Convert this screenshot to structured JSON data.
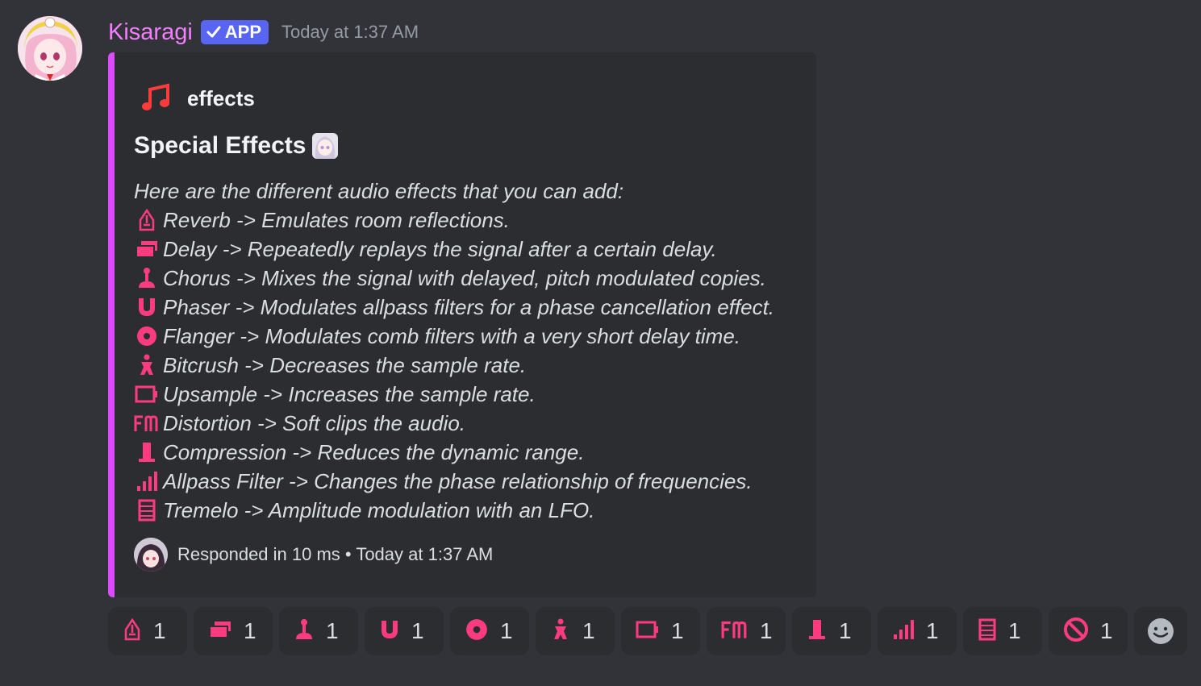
{
  "message": {
    "username": "Kisaragi",
    "badge": "APP",
    "timestamp": "Today at 1:37 AM"
  },
  "embed": {
    "author": "effects",
    "title": "Special Effects",
    "intro": "Here are the different audio effects that you can add:",
    "effects": [
      {
        "icon": "tower-icon",
        "text": "Reverb -> Emulates room reflections."
      },
      {
        "icon": "cards-icon",
        "text": "Delay -> Repeatedly replays the signal after a certain delay."
      },
      {
        "icon": "joystick-icon",
        "text": "Chorus -> Mixes the signal with delayed, pitch modulated copies."
      },
      {
        "icon": "magnet-icon",
        "text": "Phaser -> Modulates allpass filters for a phase cancellation effect."
      },
      {
        "icon": "disc-icon",
        "text": "Flanger -> Modulates comb filters with a very short delay time."
      },
      {
        "icon": "figure-icon",
        "text": "Bitcrush -> Decreases the sample rate."
      },
      {
        "icon": "battery-icon",
        "text": "Upsample -> Increases the sample rate."
      },
      {
        "icon": "fm-icon",
        "text": "Distortion -> Soft clips the audio."
      },
      {
        "icon": "pillar-icon",
        "text": "Compression -> Reduces the dynamic range."
      },
      {
        "icon": "signal-bars-icon",
        "text": "Allpass Filter -> Changes the phase relationship of frequencies."
      },
      {
        "icon": "film-icon",
        "text": "Tremelo -> Amplitude modulation with an LFO."
      }
    ],
    "footer": "Responded in 10 ms • Today at 1:37 AM"
  },
  "reactions": [
    {
      "icon": "tower-icon",
      "count": "1"
    },
    {
      "icon": "cards-icon",
      "count": "1"
    },
    {
      "icon": "joystick-icon",
      "count": "1"
    },
    {
      "icon": "magnet-icon",
      "count": "1"
    },
    {
      "icon": "disc-icon",
      "count": "1"
    },
    {
      "icon": "figure-icon",
      "count": "1"
    },
    {
      "icon": "battery-icon",
      "count": "1"
    },
    {
      "icon": "fm-icon",
      "count": "1"
    },
    {
      "icon": "pillar-icon",
      "count": "1"
    },
    {
      "icon": "signal-bars-icon",
      "count": "1"
    },
    {
      "icon": "film-icon",
      "count": "1"
    },
    {
      "icon": "prohibited-icon",
      "count": "1"
    }
  ],
  "colors": {
    "accent_pink": "#ff3b7f",
    "embed_border": "#dc4bff",
    "username": "#f47fff",
    "badge": "#5865f2"
  }
}
